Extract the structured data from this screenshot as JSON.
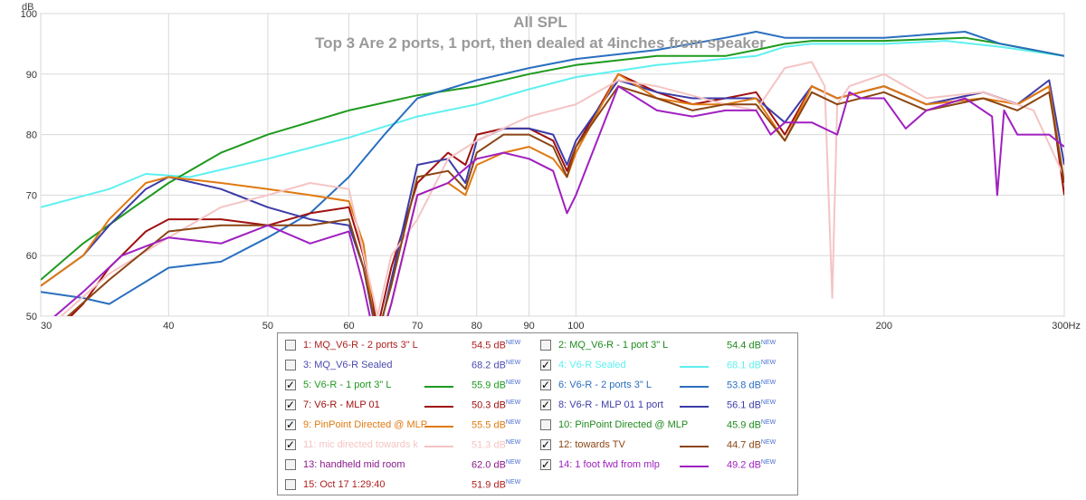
{
  "chart_data": {
    "type": "line",
    "title": "All SPL",
    "subtitle": "Top 3 Are 2 ports, 1 port, then dealed at 4inches from speaker",
    "ylabel": "dB",
    "xlabel": "",
    "x_unit": "Hz",
    "x_scale": "log",
    "xlim": [
      30,
      300
    ],
    "ylim": [
      50,
      100
    ],
    "grid": true,
    "x_ticks": [
      30,
      40,
      50,
      60,
      70,
      80,
      90,
      100,
      200,
      300
    ],
    "x_tick_labels": [
      "30",
      "40",
      "50",
      "60",
      "70",
      "80",
      "90",
      "100",
      "200",
      "300Hz"
    ],
    "y_ticks": [
      50,
      60,
      70,
      80,
      90,
      100
    ],
    "y_tick_labels": [
      "50",
      "60",
      "70",
      "80",
      "90",
      "100"
    ],
    "legend_position": "bottom-center",
    "series": [
      {
        "id": "s4",
        "visible": true,
        "color": "#5ff0f0",
        "x": [
          30,
          35,
          38,
          42,
          50,
          60,
          70,
          80,
          90,
          100,
          120,
          150,
          160,
          170,
          200,
          230,
          260,
          300
        ],
        "y": [
          68,
          71,
          73.5,
          73,
          76,
          79.5,
          83,
          85,
          87.5,
          89.5,
          91.5,
          93,
          94.5,
          95,
          95,
          95.5,
          94.5,
          93
        ]
      },
      {
        "id": "s5",
        "visible": true,
        "color": "#1e9a1e",
        "x": [
          30,
          33,
          37,
          40,
          45,
          50,
          60,
          70,
          80,
          90,
          100,
          120,
          140,
          150,
          160,
          170,
          200,
          240,
          260,
          300
        ],
        "y": [
          56,
          62,
          68,
          72,
          77,
          80,
          84,
          86.5,
          88,
          90,
          91.5,
          93,
          93,
          94,
          95,
          95.5,
          95.5,
          96,
          95,
          93
        ]
      },
      {
        "id": "s6",
        "visible": true,
        "color": "#2a6fbf",
        "x": [
          30,
          33,
          35,
          40,
          45,
          50,
          55,
          60,
          65,
          70,
          80,
          90,
          100,
          120,
          140,
          150,
          160,
          200,
          240,
          260,
          280,
          300
        ],
        "y": [
          54,
          53,
          52,
          58,
          59,
          63,
          67,
          73,
          80,
          86,
          89,
          91,
          92.5,
          94,
          96,
          97,
          96,
          96,
          97,
          95,
          94,
          93
        ]
      },
      {
        "id": "s7",
        "visible": true,
        "color": "#a01010",
        "x": [
          30,
          33,
          35,
          38,
          40,
          45,
          50,
          55,
          60,
          62,
          64,
          66,
          70,
          75,
          78,
          80,
          85,
          90,
          95,
          98,
          100,
          110,
          120,
          130,
          140,
          150,
          160,
          170,
          180,
          200,
          220,
          250,
          270,
          290,
          300
        ],
        "y": [
          45,
          52,
          58,
          64,
          66,
          66,
          65,
          67,
          68,
          60,
          48,
          58,
          72,
          77,
          75,
          80,
          81,
          81,
          79,
          74,
          78,
          90,
          87,
          85,
          86,
          87,
          80,
          88,
          86,
          88,
          85,
          87,
          85,
          88,
          70
        ]
      },
      {
        "id": "s8",
        "visible": true,
        "color": "#3c3ca8",
        "x": [
          30,
          33,
          35,
          38,
          40,
          45,
          50,
          55,
          60,
          62,
          64,
          66,
          70,
          75,
          78,
          80,
          85,
          90,
          95,
          98,
          100,
          110,
          120,
          130,
          140,
          150,
          160,
          170,
          180,
          200,
          220,
          250,
          270,
          290,
          300
        ],
        "y": [
          55,
          60,
          65,
          71,
          73,
          71,
          68,
          66,
          65,
          58,
          46,
          56,
          75,
          76,
          72,
          79,
          81,
          81,
          80,
          75,
          79,
          89,
          87,
          86,
          86,
          86,
          82,
          88,
          86,
          88,
          85,
          87,
          85,
          89,
          75
        ]
      },
      {
        "id": "s9",
        "visible": true,
        "color": "#e07a10",
        "x": [
          30,
          33,
          35,
          38,
          40,
          45,
          50,
          55,
          60,
          62,
          64,
          66,
          70,
          75,
          78,
          80,
          85,
          90,
          95,
          98,
          100,
          110,
          120,
          130,
          140,
          150,
          160,
          170,
          180,
          200,
          220,
          250,
          270,
          290,
          300
        ],
        "y": [
          55,
          60,
          66,
          72,
          73,
          72,
          71,
          70,
          69,
          62,
          45,
          52,
          70,
          72,
          70,
          75,
          77,
          78,
          76,
          73,
          77,
          90,
          86,
          85,
          85,
          86,
          79,
          88,
          86,
          88,
          85,
          86,
          85,
          88,
          72
        ]
      },
      {
        "id": "s11",
        "visible": true,
        "color": "#f5c4c4",
        "x": [
          30,
          35,
          40,
          45,
          50,
          55,
          60,
          64,
          66,
          70,
          75,
          80,
          90,
          100,
          110,
          120,
          140,
          150,
          160,
          170,
          175,
          178,
          180,
          185,
          200,
          220,
          250,
          280,
          300
        ],
        "y": [
          47,
          57,
          63,
          68,
          70,
          72,
          71,
          50,
          60,
          66,
          76,
          79,
          83,
          85,
          89,
          88,
          85,
          84,
          91,
          92,
          88,
          53,
          85,
          88,
          90,
          86,
          87,
          84,
          73
        ]
      },
      {
        "id": "s12",
        "visible": true,
        "color": "#8b4513",
        "x": [
          30,
          35,
          40,
          45,
          50,
          55,
          60,
          62,
          64,
          66,
          70,
          75,
          78,
          80,
          85,
          90,
          95,
          98,
          100,
          110,
          120,
          130,
          140,
          150,
          160,
          170,
          180,
          200,
          220,
          250,
          270,
          290,
          300
        ],
        "y": [
          46,
          56,
          64,
          65,
          65,
          65,
          66,
          58,
          47,
          55,
          73,
          74,
          71,
          77,
          80,
          80,
          78,
          73,
          78,
          88,
          86,
          84,
          85,
          85,
          79,
          87,
          85,
          87,
          84,
          86,
          84,
          87,
          72
        ]
      },
      {
        "id": "s14",
        "visible": true,
        "color": "#a020c0",
        "x": [
          30,
          33,
          36,
          40,
          45,
          50,
          55,
          60,
          62,
          64,
          66,
          70,
          75,
          80,
          85,
          90,
          95,
          98,
          100,
          110,
          120,
          130,
          140,
          150,
          155,
          160,
          170,
          180,
          185,
          190,
          200,
          210,
          220,
          240,
          255,
          258,
          262,
          270,
          290,
          300
        ],
        "y": [
          48,
          54,
          60,
          63,
          62,
          65,
          62,
          64,
          55,
          44,
          52,
          70,
          72,
          76,
          77,
          76,
          74,
          67,
          70,
          88,
          84,
          83,
          84,
          84,
          80,
          82,
          82,
          80,
          87,
          86,
          86,
          81,
          84,
          86,
          83,
          70,
          84,
          80,
          80,
          78
        ]
      }
    ],
    "legend": [
      {
        "num": "1:",
        "name": "MQ_V6-R - 2 ports 3\" L",
        "value": "54.5 dB",
        "checked": false,
        "color": "#b02020",
        "swatch": false
      },
      {
        "num": "2:",
        "name": "MQ_V6-R - 1 port 3\" L",
        "value": "54.4 dB",
        "checked": false,
        "color": "#1e8a1e",
        "swatch": false
      },
      {
        "num": "3:",
        "name": "MQ_V6-R Sealed",
        "value": "68.2 dB",
        "checked": false,
        "color": "#4a4ab0",
        "swatch": false
      },
      {
        "num": "4:",
        "name": "V6-R Sealed",
        "value": "68.1 dB",
        "checked": true,
        "color": "#5ff0f0",
        "swatch": true
      },
      {
        "num": "5:",
        "name": "V6-R - 1 port 3\" L",
        "value": "55.9 dB",
        "checked": true,
        "color": "#1e9a1e",
        "swatch": true
      },
      {
        "num": "6:",
        "name": "V6-R - 2 ports 3\" L",
        "value": "53.8 dB",
        "checked": true,
        "color": "#2a6fbf",
        "swatch": true
      },
      {
        "num": "7:",
        "name": "V6-R -  MLP  01",
        "value": "50.3 dB",
        "checked": true,
        "color": "#a01010",
        "swatch": true
      },
      {
        "num": "8:",
        "name": "V6-R -  MLP  01 1 port",
        "value": "56.1 dB",
        "checked": true,
        "color": "#3c3ca8",
        "swatch": true
      },
      {
        "num": "9:",
        "name": "PinPoint Directed @ MLP",
        "value": "55.5 dB",
        "checked": true,
        "color": "#e07a10",
        "swatch": true
      },
      {
        "num": "10:",
        "name": "PinPoint Directed @ MLP",
        "value": "45.9 dB",
        "checked": false,
        "color": "#1e8a1e",
        "swatch": false
      },
      {
        "num": "11:",
        "name": "mic directed towards k",
        "value": "51.3 dB",
        "checked": true,
        "color": "#f5c4c4",
        "swatch": true
      },
      {
        "num": "12:",
        "name": "towards TV",
        "value": "44.7 dB",
        "checked": true,
        "color": "#8b4513",
        "swatch": true
      },
      {
        "num": "13:",
        "name": "handheld mid room",
        "value": "62.0 dB",
        "checked": false,
        "color": "#8a1a8a",
        "swatch": false
      },
      {
        "num": "14:",
        "name": "1 foot fwd from mlp",
        "value": "49.2 dB",
        "checked": true,
        "color": "#a020c0",
        "swatch": true
      },
      {
        "num": "15:",
        "name": "Oct 17 1:29:40",
        "value": "51.9 dB",
        "checked": false,
        "color": "#b02020",
        "swatch": false
      }
    ],
    "value_suffix": "NEW",
    "checkmark": "✓"
  }
}
